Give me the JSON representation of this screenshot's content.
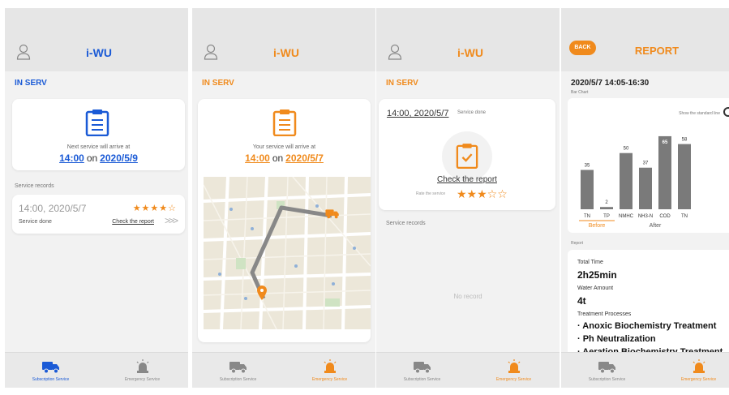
{
  "colors": {
    "blue": "#1a5ad6",
    "orange": "#f08a1c",
    "bar": "#7a7a7a"
  },
  "screens": [
    {
      "title": "i-WU",
      "section": "IN SERV",
      "next_label": "Next service will arrive at",
      "time": "14:00",
      "on": "on",
      "date": "2020/5/9",
      "records_label": "Service records",
      "record": {
        "time": "14:00, 2020/5/7",
        "rating": 4,
        "stars": "★★★★☆",
        "status": "Service done",
        "link": "Check the report",
        "chevrons": ">>>"
      }
    },
    {
      "title": "i-WU",
      "section": "IN SERV",
      "next_label": "Your service will arrive at",
      "time": "14:00",
      "on": "on",
      "date": "2020/5/7"
    },
    {
      "title": "i-WU",
      "section": "IN SERV",
      "time": "14:00, 2020/5/7",
      "status": "Service done",
      "check": "Check the report",
      "rate_label": "Rate the service",
      "rating": 3,
      "stars_filled": "★★★",
      "stars_empty": "☆☆",
      "records_label": "Service records",
      "no_record": "No record"
    },
    {
      "back": "BACK",
      "title": "REPORT",
      "date": "2020/5/7 14:05-16:30",
      "subtitle": "Bar Chart",
      "std_label": "Show the standard line",
      "report_label": "Report",
      "fields": [
        {
          "label": "Total Time",
          "value": "2h25min"
        },
        {
          "label": "Water Amount",
          "value": "4t"
        }
      ],
      "process_label": "Treatment Processes",
      "processes": [
        "· Anoxic Biochemistry Treatment",
        "· Ph Neutralization",
        "· Aeration Biochemistry Treatment"
      ]
    }
  ],
  "tabbar": {
    "subscription": "Subscription Service",
    "emergency": "Emergency Service"
  },
  "icons": {
    "user": "user-icon",
    "clipboard": "clipboard-icon",
    "truck": "truck-icon",
    "siren": "siren-icon",
    "pin": "map-pin-icon"
  },
  "chart_data": {
    "type": "bar",
    "categories": [
      "TN",
      "TP",
      "NMHC",
      "NH3-N",
      "COD",
      "TN"
    ],
    "values": [
      35,
      2,
      50,
      37,
      65,
      58
    ],
    "groups": [
      {
        "label": "Before",
        "count": 2
      },
      {
        "label": "After",
        "count": 4
      }
    ],
    "ylim": [
      0,
      70
    ],
    "grid": false,
    "legend": "none"
  }
}
